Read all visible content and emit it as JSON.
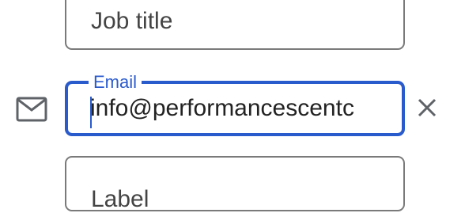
{
  "contact_form": {
    "job_title": {
      "placeholder": "Job title"
    },
    "email": {
      "label": "Email",
      "value": "info@performancescentc"
    },
    "label_field": {
      "placeholder": "Label"
    }
  },
  "icons": {
    "email": "mail-icon",
    "clear": "close-icon"
  },
  "colors": {
    "accent": "#2a5bcd",
    "border": "#7a7a7a",
    "icon": "#5f6368",
    "text": "#444444"
  }
}
